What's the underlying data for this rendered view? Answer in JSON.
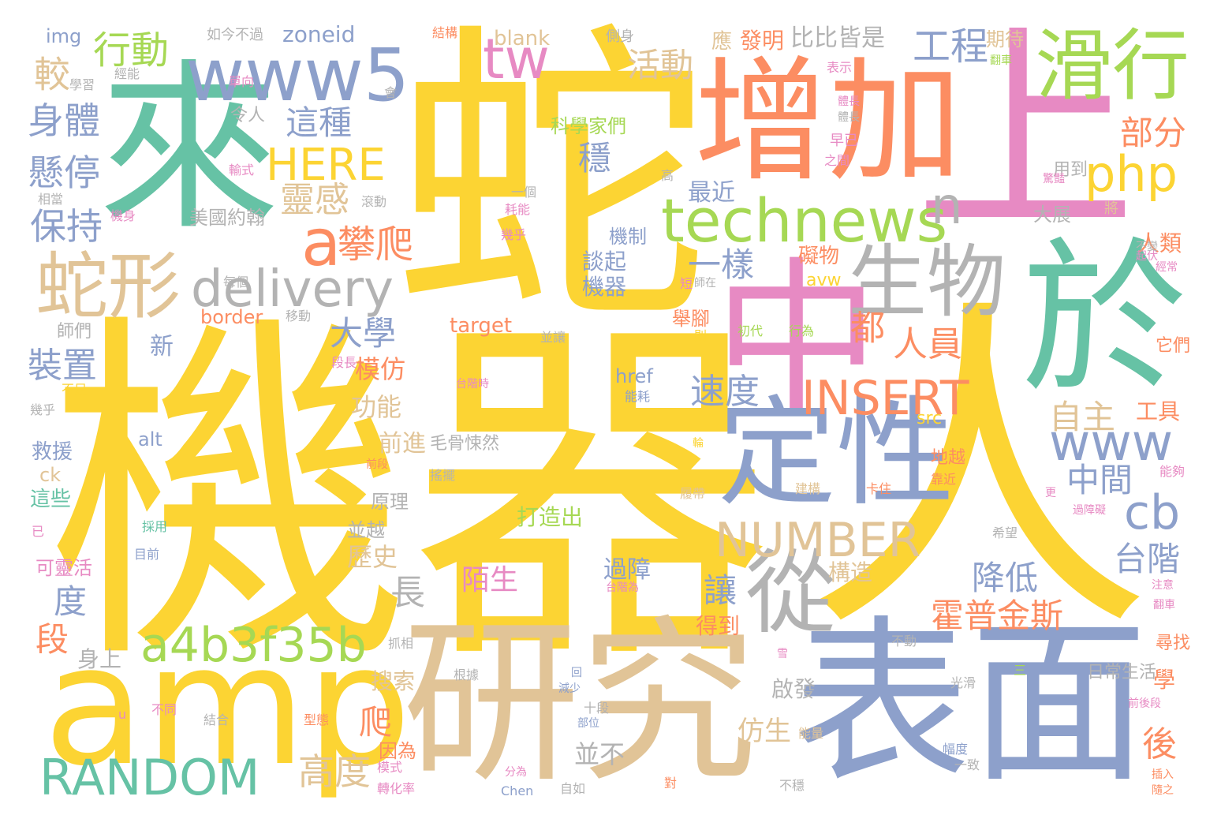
{
  "colors": {
    "yellow": "#fcd433",
    "tan": "#e1c497",
    "blue": "#8da0cb",
    "orange": "#fc8d62",
    "teal": "#66c2a5",
    "gray": "#b3b3b3",
    "green": "#a6d854",
    "pink": "#e78ac3"
  },
  "words": [
    {
      "id": "w1",
      "text": "蛇",
      "color": "yellow"
    },
    {
      "id": "w2",
      "text": "機器",
      "color": "yellow"
    },
    {
      "id": "w3",
      "text": "人",
      "color": "yellow"
    },
    {
      "id": "w4",
      "text": "來",
      "color": "teal"
    },
    {
      "id": "w5",
      "text": "增加",
      "color": "orange"
    },
    {
      "id": "w6",
      "text": "上",
      "color": "pink"
    },
    {
      "id": "w7",
      "text": "www5",
      "color": "blue"
    },
    {
      "id": "w8",
      "text": "滑行",
      "color": "green"
    },
    {
      "id": "w9",
      "text": "amp",
      "color": "yellow"
    },
    {
      "id": "w10",
      "text": "研究",
      "color": "tan"
    },
    {
      "id": "w11",
      "text": "表面",
      "color": "blue"
    },
    {
      "id": "w12",
      "text": "中",
      "color": "pink"
    },
    {
      "id": "w13",
      "text": "於",
      "color": "teal"
    },
    {
      "id": "w14",
      "text": "定性",
      "color": "blue"
    },
    {
      "id": "w15",
      "text": "生物",
      "color": "gray"
    },
    {
      "id": "w16",
      "text": "從",
      "color": "gray"
    },
    {
      "id": "w17",
      "text": "蛇形",
      "color": "tan"
    },
    {
      "id": "w18",
      "text": "technews",
      "color": "green"
    },
    {
      "id": "w19",
      "text": "a4b3f35b",
      "color": "green"
    },
    {
      "id": "w20",
      "text": "RANDOM",
      "color": "teal"
    },
    {
      "id": "w21",
      "text": "NUMBER",
      "color": "tan"
    },
    {
      "id": "w22",
      "text": "INSERT",
      "color": "orange"
    },
    {
      "id": "w23",
      "text": "delivery",
      "color": "gray"
    },
    {
      "id": "w24",
      "text": "HERE",
      "color": "yellow"
    },
    {
      "id": "w25",
      "text": "php",
      "color": "yellow"
    },
    {
      "id": "w26",
      "text": "tw",
      "color": "pink"
    },
    {
      "id": "w27",
      "text": "www",
      "color": "blue"
    },
    {
      "id": "w28",
      "text": "cb",
      "color": "blue"
    },
    {
      "id": "w29",
      "text": "a",
      "color": "orange"
    },
    {
      "id": "w30",
      "text": "攀爬",
      "color": "orange"
    },
    {
      "id": "w31",
      "text": "行動",
      "color": "green"
    },
    {
      "id": "w32",
      "text": "身體",
      "color": "blue"
    },
    {
      "id": "w33",
      "text": "懸停",
      "color": "blue"
    },
    {
      "id": "w34",
      "text": "保持",
      "color": "blue"
    },
    {
      "id": "w35",
      "text": "較",
      "color": "tan"
    },
    {
      "id": "w36",
      "text": "這種",
      "color": "blue"
    },
    {
      "id": "w37",
      "text": "靈感",
      "color": "tan"
    },
    {
      "id": "w38",
      "text": "活動",
      "color": "tan"
    },
    {
      "id": "w39",
      "text": "工程",
      "color": "blue"
    },
    {
      "id": "w40",
      "text": "比比皆是",
      "color": "gray"
    },
    {
      "id": "w41",
      "text": "部分",
      "color": "orange"
    },
    {
      "id": "w42",
      "text": "最近",
      "color": "blue"
    },
    {
      "id": "w43",
      "text": "一樣",
      "color": "blue"
    },
    {
      "id": "w44",
      "text": "大學",
      "color": "blue"
    },
    {
      "id": "w45",
      "text": "裝置",
      "color": "blue"
    },
    {
      "id": "w46",
      "text": "模仿",
      "color": "orange"
    },
    {
      "id": "w47",
      "text": "都",
      "color": "orange"
    },
    {
      "id": "w48",
      "text": "人員",
      "color": "orange"
    },
    {
      "id": "w49",
      "text": "速度",
      "color": "blue"
    },
    {
      "id": "w50",
      "text": "自主",
      "color": "tan"
    },
    {
      "id": "w51",
      "text": "中間",
      "color": "blue"
    },
    {
      "id": "w52",
      "text": "台階",
      "color": "blue"
    },
    {
      "id": "w53",
      "text": "降低",
      "color": "blue"
    },
    {
      "id": "w54",
      "text": "霍普金斯",
      "color": "orange"
    },
    {
      "id": "w55",
      "text": "長",
      "color": "gray"
    },
    {
      "id": "w56",
      "text": "讓",
      "color": "blue"
    },
    {
      "id": "w57",
      "text": "度",
      "color": "blue"
    },
    {
      "id": "w58",
      "text": "段",
      "color": "orange"
    },
    {
      "id": "w59",
      "text": "高度",
      "color": "tan"
    },
    {
      "id": "w60",
      "text": "後",
      "color": "orange"
    },
    {
      "id": "w61",
      "text": "爬",
      "color": "orange"
    },
    {
      "id": "w62",
      "text": "穩",
      "color": "blue"
    },
    {
      "id": "w63",
      "text": "n",
      "color": "gray"
    },
    {
      "id": "w64",
      "text": "歷史",
      "color": "tan"
    },
    {
      "id": "w65",
      "text": "陌生",
      "color": "pink"
    },
    {
      "id": "w66",
      "text": "過障",
      "color": "blue"
    },
    {
      "id": "w67",
      "text": "仿生",
      "color": "tan"
    },
    {
      "id": "w68",
      "text": "新",
      "color": "blue"
    },
    {
      "id": "w69",
      "text": "功能",
      "color": "tan"
    },
    {
      "id": "w70",
      "text": "前進",
      "color": "tan"
    },
    {
      "id": "w71",
      "text": "zoneid",
      "color": "blue"
    },
    {
      "id": "w72",
      "text": "blank",
      "color": "tan"
    },
    {
      "id": "w73",
      "text": "border",
      "color": "orange"
    },
    {
      "id": "w74",
      "text": "target",
      "color": "orange"
    },
    {
      "id": "w75",
      "text": "href",
      "color": "blue"
    },
    {
      "id": "w76",
      "text": "alt",
      "color": "blue"
    },
    {
      "id": "w77",
      "text": "src",
      "color": "yellow"
    },
    {
      "id": "w78",
      "text": "avw",
      "color": "yellow"
    },
    {
      "id": "w79",
      "text": "img",
      "color": "blue"
    },
    {
      "id": "w80",
      "text": "ck",
      "color": "tan"
    },
    {
      "id": "w81",
      "text": "發明",
      "color": "orange"
    },
    {
      "id": "w82",
      "text": "應",
      "color": "tan"
    },
    {
      "id": "w83",
      "text": "期待",
      "color": "tan"
    },
    {
      "id": "w84",
      "text": "美國約翰",
      "color": "gray"
    },
    {
      "id": "w85",
      "text": "科學家們",
      "color": "green"
    },
    {
      "id": "w86",
      "text": "機制",
      "color": "blue"
    },
    {
      "id": "w87",
      "text": "談起",
      "color": "blue"
    },
    {
      "id": "w88",
      "text": "機器",
      "color": "blue"
    },
    {
      "id": "w89",
      "text": "礙物",
      "color": "orange"
    },
    {
      "id": "w90",
      "text": "舉腳",
      "color": "orange"
    },
    {
      "id": "w91",
      "text": "工具",
      "color": "orange"
    },
    {
      "id": "w92",
      "text": "學",
      "color": "orange"
    },
    {
      "id": "w93",
      "text": "人類",
      "color": "orange"
    },
    {
      "id": "w94",
      "text": "大展",
      "color": "gray"
    },
    {
      "id": "w95",
      "text": "用到",
      "color": "gray"
    },
    {
      "id": "w96",
      "text": "並越",
      "color": "gray"
    },
    {
      "id": "w97",
      "text": "原理",
      "color": "gray"
    },
    {
      "id": "w98",
      "text": "打造出",
      "color": "green"
    },
    {
      "id": "w99",
      "text": "搜索",
      "color": "tan"
    },
    {
      "id": "w100",
      "text": "身上",
      "color": "gray"
    },
    {
      "id": "w101",
      "text": "得到",
      "color": "orange"
    },
    {
      "id": "w102",
      "text": "啟發",
      "color": "gray"
    },
    {
      "id": "w103",
      "text": "並不",
      "color": "gray"
    },
    {
      "id": "w104",
      "text": "構造",
      "color": "tan"
    },
    {
      "id": "w105",
      "text": "救援",
      "color": "blue"
    },
    {
      "id": "w106",
      "text": "這些",
      "color": "teal"
    },
    {
      "id": "w107",
      "text": "可靈活",
      "color": "pink"
    },
    {
      "id": "w108",
      "text": "師們",
      "color": "gray"
    },
    {
      "id": "w109",
      "text": "因為",
      "color": "orange"
    },
    {
      "id": "w110",
      "text": "毛骨悚然",
      "color": "gray"
    },
    {
      "id": "w111",
      "text": "日常生活",
      "color": "gray"
    },
    {
      "id": "w112",
      "text": "尋找",
      "color": "orange"
    },
    {
      "id": "w113",
      "text": "地越",
      "color": "orange"
    },
    {
      "id": "w114",
      "text": "它們",
      "color": "orange"
    },
    {
      "id": "w115",
      "text": "如今不過",
      "color": "gray"
    },
    {
      "id": "w116",
      "text": "結構",
      "color": "orange"
    },
    {
      "id": "w117",
      "text": "側身",
      "color": "gray"
    },
    {
      "id": "w118",
      "text": "表示",
      "color": "pink"
    },
    {
      "id": "w119",
      "text": "令人",
      "color": "gray"
    },
    {
      "id": "w120",
      "text": "早已",
      "color": "pink"
    },
    {
      "id": "w121",
      "text": "之間",
      "color": "pink"
    },
    {
      "id": "w122",
      "text": "經能",
      "color": "gray"
    },
    {
      "id": "w123",
      "text": "學習",
      "color": "gray"
    },
    {
      "id": "w124",
      "text": "單向",
      "color": "pink"
    },
    {
      "id": "w125",
      "text": "會",
      "color": "gray"
    },
    {
      "id": "w126",
      "text": "輸式",
      "color": "pink"
    },
    {
      "id": "w127",
      "text": "相當",
      "color": "gray"
    },
    {
      "id": "w128",
      "text": "滾動",
      "color": "gray"
    },
    {
      "id": "w129",
      "text": "機身",
      "color": "pink"
    },
    {
      "id": "w130",
      "text": "每個",
      "color": "gray"
    },
    {
      "id": "w131",
      "text": "移動",
      "color": "gray"
    },
    {
      "id": "w132",
      "text": "一個",
      "color": "gray"
    },
    {
      "id": "w133",
      "text": "耗能",
      "color": "pink"
    },
    {
      "id": "w134",
      "text": "幾乎",
      "color": "pink"
    },
    {
      "id": "w135",
      "text": "初代",
      "color": "green"
    },
    {
      "id": "w136",
      "text": "行為",
      "color": "green"
    },
    {
      "id": "w137",
      "text": "則",
      "color": "yellow"
    },
    {
      "id": "w138",
      "text": "短",
      "color": "pink"
    },
    {
      "id": "w139",
      "text": "師在",
      "color": "gray"
    },
    {
      "id": "w140",
      "text": "並讓",
      "color": "gray"
    },
    {
      "id": "w141",
      "text": "不足",
      "color": "yellow"
    },
    {
      "id": "w142",
      "text": "幾乎",
      "color": "gray"
    },
    {
      "id": "w143",
      "text": "段長",
      "color": "pink"
    },
    {
      "id": "w144",
      "text": "台階時",
      "color": "pink"
    },
    {
      "id": "w145",
      "text": "例",
      "color": "yellow"
    },
    {
      "id": "w146",
      "text": "能耗",
      "color": "blue"
    },
    {
      "id": "w147",
      "text": "輪",
      "color": "yellow"
    },
    {
      "id": "w148",
      "text": "前段",
      "color": "orange"
    },
    {
      "id": "w149",
      "text": "搖擺",
      "color": "gray"
    },
    {
      "id": "w150",
      "text": "履帶",
      "color": "tan"
    },
    {
      "id": "w151",
      "text": "建構",
      "color": "tan"
    },
    {
      "id": "w152",
      "text": "卡住",
      "color": "orange"
    },
    {
      "id": "w153",
      "text": "靠近",
      "color": "orange"
    },
    {
      "id": "w154",
      "text": "更",
      "color": "pink"
    },
    {
      "id": "w155",
      "text": "能夠",
      "color": "pink"
    },
    {
      "id": "w156",
      "text": "過障礙",
      "color": "pink"
    },
    {
      "id": "w157",
      "text": "希望",
      "color": "gray"
    },
    {
      "id": "w158",
      "text": "採用",
      "color": "teal"
    },
    {
      "id": "w159",
      "text": "目前",
      "color": "blue"
    },
    {
      "id": "w160",
      "text": "已",
      "color": "pink"
    },
    {
      "id": "w161",
      "text": "台階為",
      "color": "pink"
    },
    {
      "id": "w162",
      "text": "注意",
      "color": "pink"
    },
    {
      "id": "w163",
      "text": "翻車",
      "color": "pink"
    },
    {
      "id": "w164",
      "text": "抓相",
      "color": "gray"
    },
    {
      "id": "w165",
      "text": "雪",
      "color": "pink"
    },
    {
      "id": "w166",
      "text": "不動",
      "color": "gray"
    },
    {
      "id": "w167",
      "text": "根據",
      "color": "gray"
    },
    {
      "id": "w168",
      "text": "回",
      "color": "blue"
    },
    {
      "id": "w169",
      "text": "減少",
      "color": "blue"
    },
    {
      "id": "w170",
      "text": "三",
      "color": "green"
    },
    {
      "id": "w171",
      "text": "光滑",
      "color": "gray"
    },
    {
      "id": "w172",
      "text": "前後段",
      "color": "pink"
    },
    {
      "id": "w173",
      "text": "不同",
      "color": "pink"
    },
    {
      "id": "w174",
      "text": "結合",
      "color": "gray"
    },
    {
      "id": "w175",
      "text": "型態",
      "color": "orange"
    },
    {
      "id": "w176",
      "text": "十段",
      "color": "gray"
    },
    {
      "id": "w177",
      "text": "部位",
      "color": "blue"
    },
    {
      "id": "w178",
      "text": "能量",
      "color": "tan"
    },
    {
      "id": "w179",
      "text": "幅度",
      "color": "blue"
    },
    {
      "id": "w180",
      "text": "一致",
      "color": "gray"
    },
    {
      "id": "w181",
      "text": "模式",
      "color": "pink"
    },
    {
      "id": "w182",
      "text": "轉化率",
      "color": "pink"
    },
    {
      "id": "w183",
      "text": "分為",
      "color": "pink"
    },
    {
      "id": "w184",
      "text": "Chen",
      "color": "blue"
    },
    {
      "id": "w185",
      "text": "自如",
      "color": "gray"
    },
    {
      "id": "w186",
      "text": "對",
      "color": "orange"
    },
    {
      "id": "w187",
      "text": "不穩",
      "color": "gray"
    },
    {
      "id": "w188",
      "text": "插入",
      "color": "orange"
    },
    {
      "id": "w189",
      "text": "隨之",
      "color": "orange"
    },
    {
      "id": "w190",
      "text": "起伏",
      "color": "pink"
    },
    {
      "id": "w191",
      "text": "經常",
      "color": "pink"
    },
    {
      "id": "w192",
      "text": "不變",
      "color": "gray"
    },
    {
      "id": "w193",
      "text": "將",
      "color": "tan"
    },
    {
      "id": "w194",
      "text": "u",
      "color": "pink"
    },
    {
      "id": "w195",
      "text": "高",
      "color": "gray"
    },
    {
      "id": "w196",
      "text": "體長",
      "color": "pink"
    },
    {
      "id": "w197",
      "text": "體長",
      "color": "gray"
    },
    {
      "id": "w198",
      "text": "驚豔",
      "color": "pink"
    },
    {
      "id": "w199",
      "text": "翻車",
      "color": "green"
    }
  ]
}
